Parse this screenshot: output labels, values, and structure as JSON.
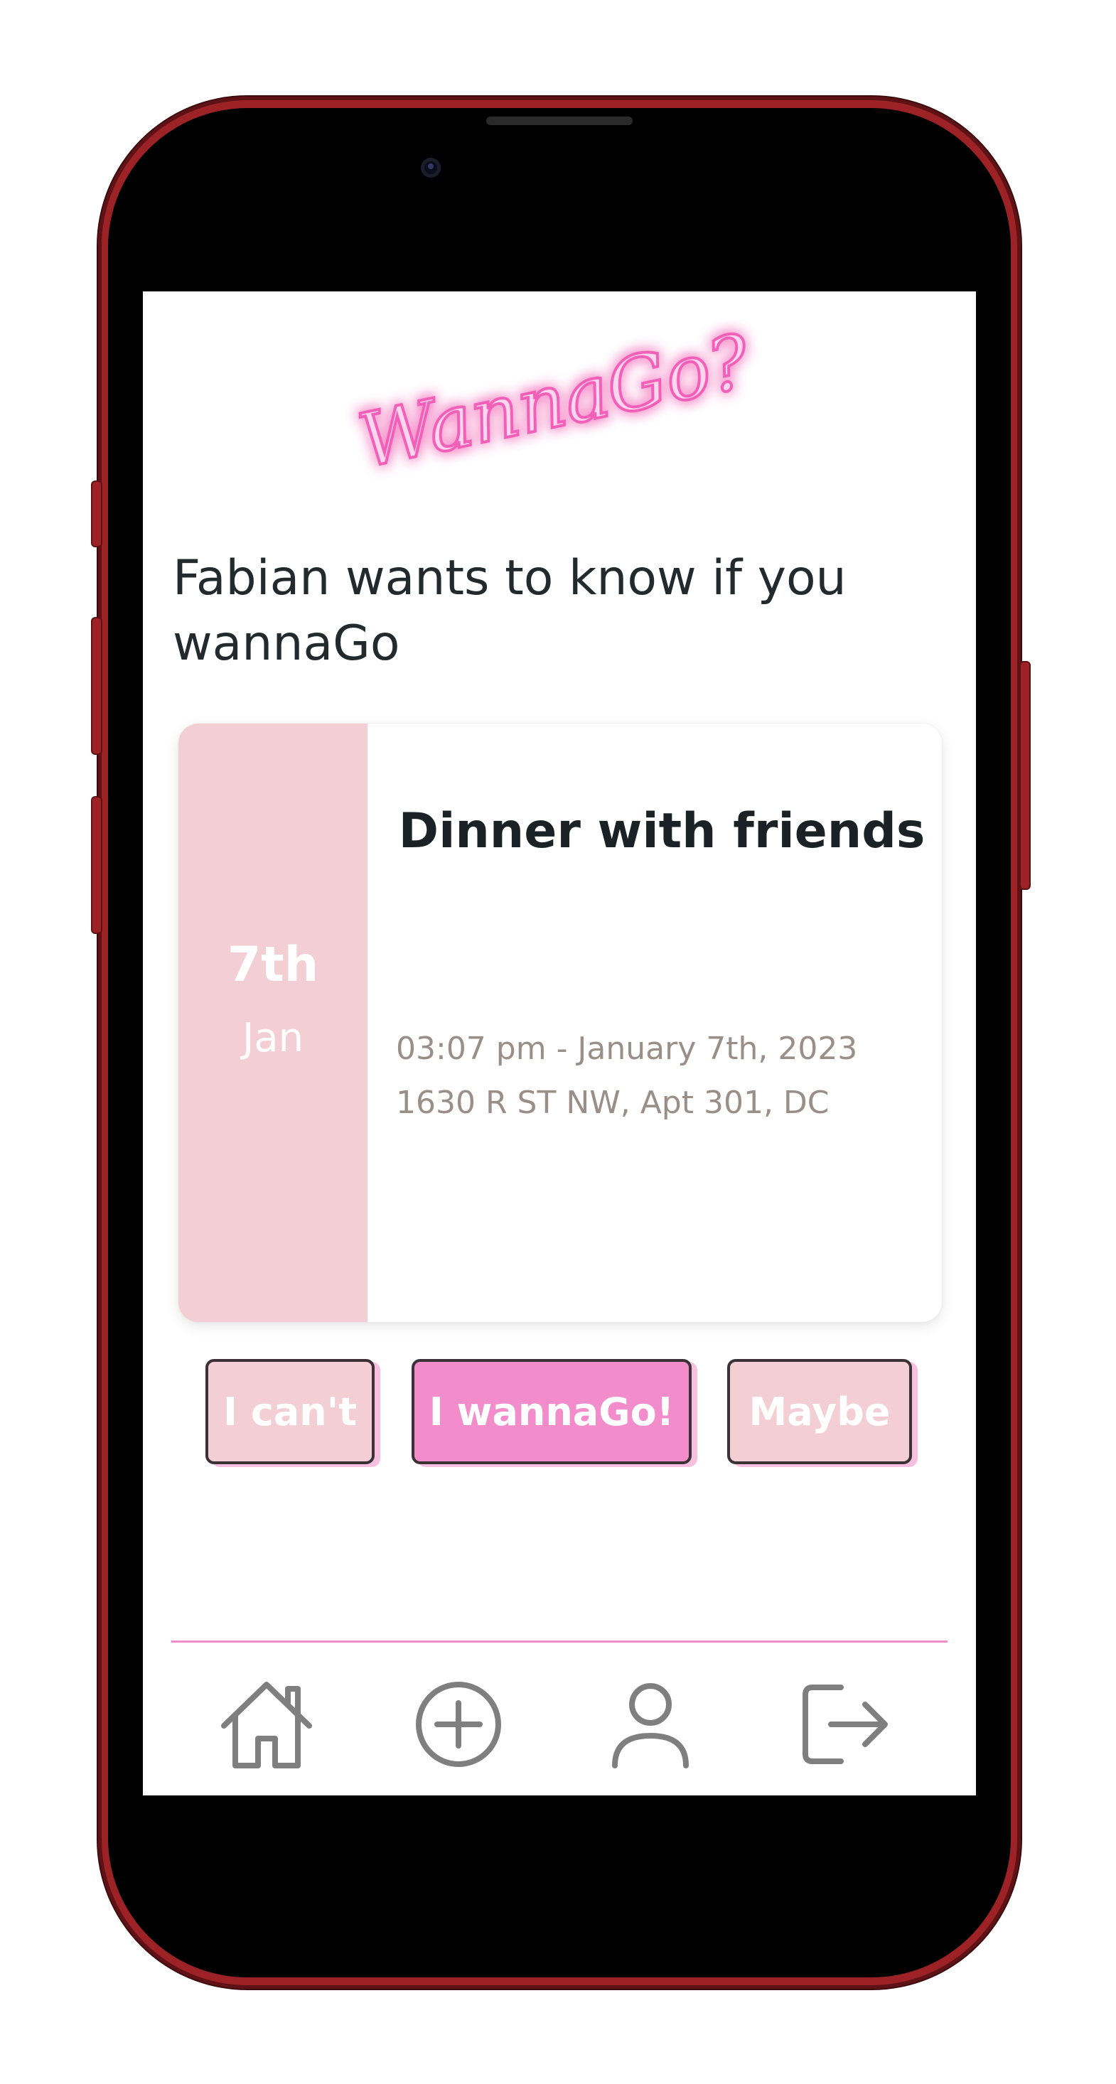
{
  "app": {
    "logo_text": "WannaGo?"
  },
  "invite": {
    "headline": "Fabian wants to know if you wannaGo"
  },
  "event": {
    "day": "7th",
    "month": "Jan",
    "title": "Dinner with friends",
    "datetime": "03:07 pm - January 7th, 2023",
    "address": "1630 R ST NW, Apt 301, DC"
  },
  "actions": {
    "cant_label": "I can't",
    "go_label": "I wannaGo!",
    "maybe_label": "Maybe"
  },
  "nav": {
    "items": [
      {
        "icon": "home-icon"
      },
      {
        "icon": "plus-circle-icon"
      },
      {
        "icon": "user-icon"
      },
      {
        "icon": "logout-icon"
      }
    ]
  },
  "colors": {
    "accent_pink": "#f28ccb",
    "light_pink": "#f3cfd5",
    "frame_red": "#9c2226",
    "text_dark": "#222a2e",
    "text_muted": "#9a8f88",
    "icon_gray": "#7f7f7f"
  }
}
